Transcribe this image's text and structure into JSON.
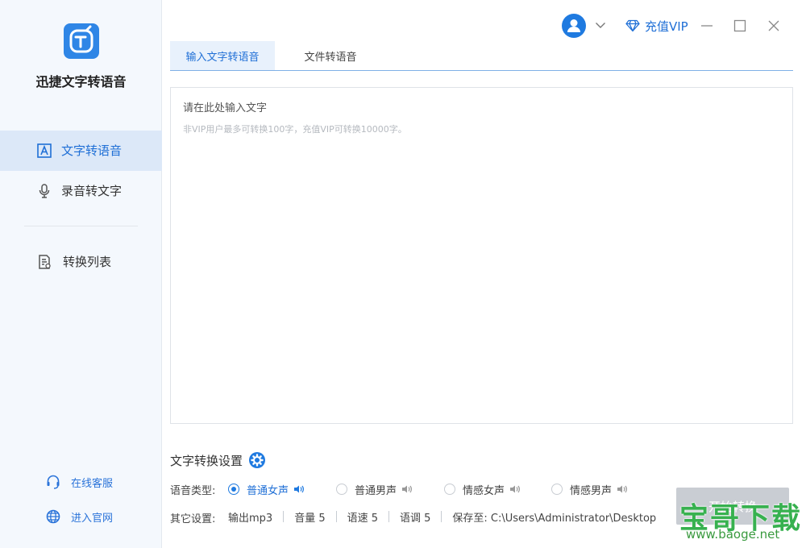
{
  "app": {
    "name": "迅捷文字转语音"
  },
  "sidebar": {
    "nav": [
      {
        "label": "文字转语音",
        "active": true,
        "icon": "text-a-icon"
      },
      {
        "label": "录音转文字",
        "active": false,
        "icon": "microphone-icon"
      },
      {
        "label": "转换列表",
        "active": false,
        "icon": "list-document-icon"
      }
    ],
    "links": [
      {
        "label": "在线客服",
        "icon": "customer-service-icon"
      },
      {
        "label": "进入官网",
        "icon": "globe-icon"
      }
    ]
  },
  "titlebar": {
    "vip_label": "充值VIP"
  },
  "tabs": [
    {
      "label": "输入文字转语音",
      "active": true
    },
    {
      "label": "文件转语音",
      "active": false
    }
  ],
  "editor": {
    "placeholder": "请在此处输入文字",
    "hint": "非VIP用户最多可转换100字，充值VIP可转换10000字。"
  },
  "settings": {
    "title": "文字转换设置",
    "voice_type_label": "语音类型:",
    "voices": [
      {
        "label": "普通女声",
        "selected": true
      },
      {
        "label": "普通男声",
        "selected": false
      },
      {
        "label": "情感女声",
        "selected": false
      },
      {
        "label": "情感男声",
        "selected": false
      }
    ],
    "other_label": "其它设置:",
    "options": {
      "output": "输出mp3",
      "volume": "音量 5",
      "speed": "语速 5",
      "pitch": "语调 5",
      "save_to": "保存至: C:\\Users\\Administrator\\Desktop"
    }
  },
  "convert_button": {
    "label": "开始转换"
  },
  "watermark": {
    "big": "宝哥下载",
    "small": "www.baoge.net"
  },
  "colors": {
    "accent": "#1f7ae0",
    "sidebar_bg": "#f4f8fd",
    "active_nav_bg": "#dce8f8",
    "button_disabled": "#c9cdd3"
  }
}
